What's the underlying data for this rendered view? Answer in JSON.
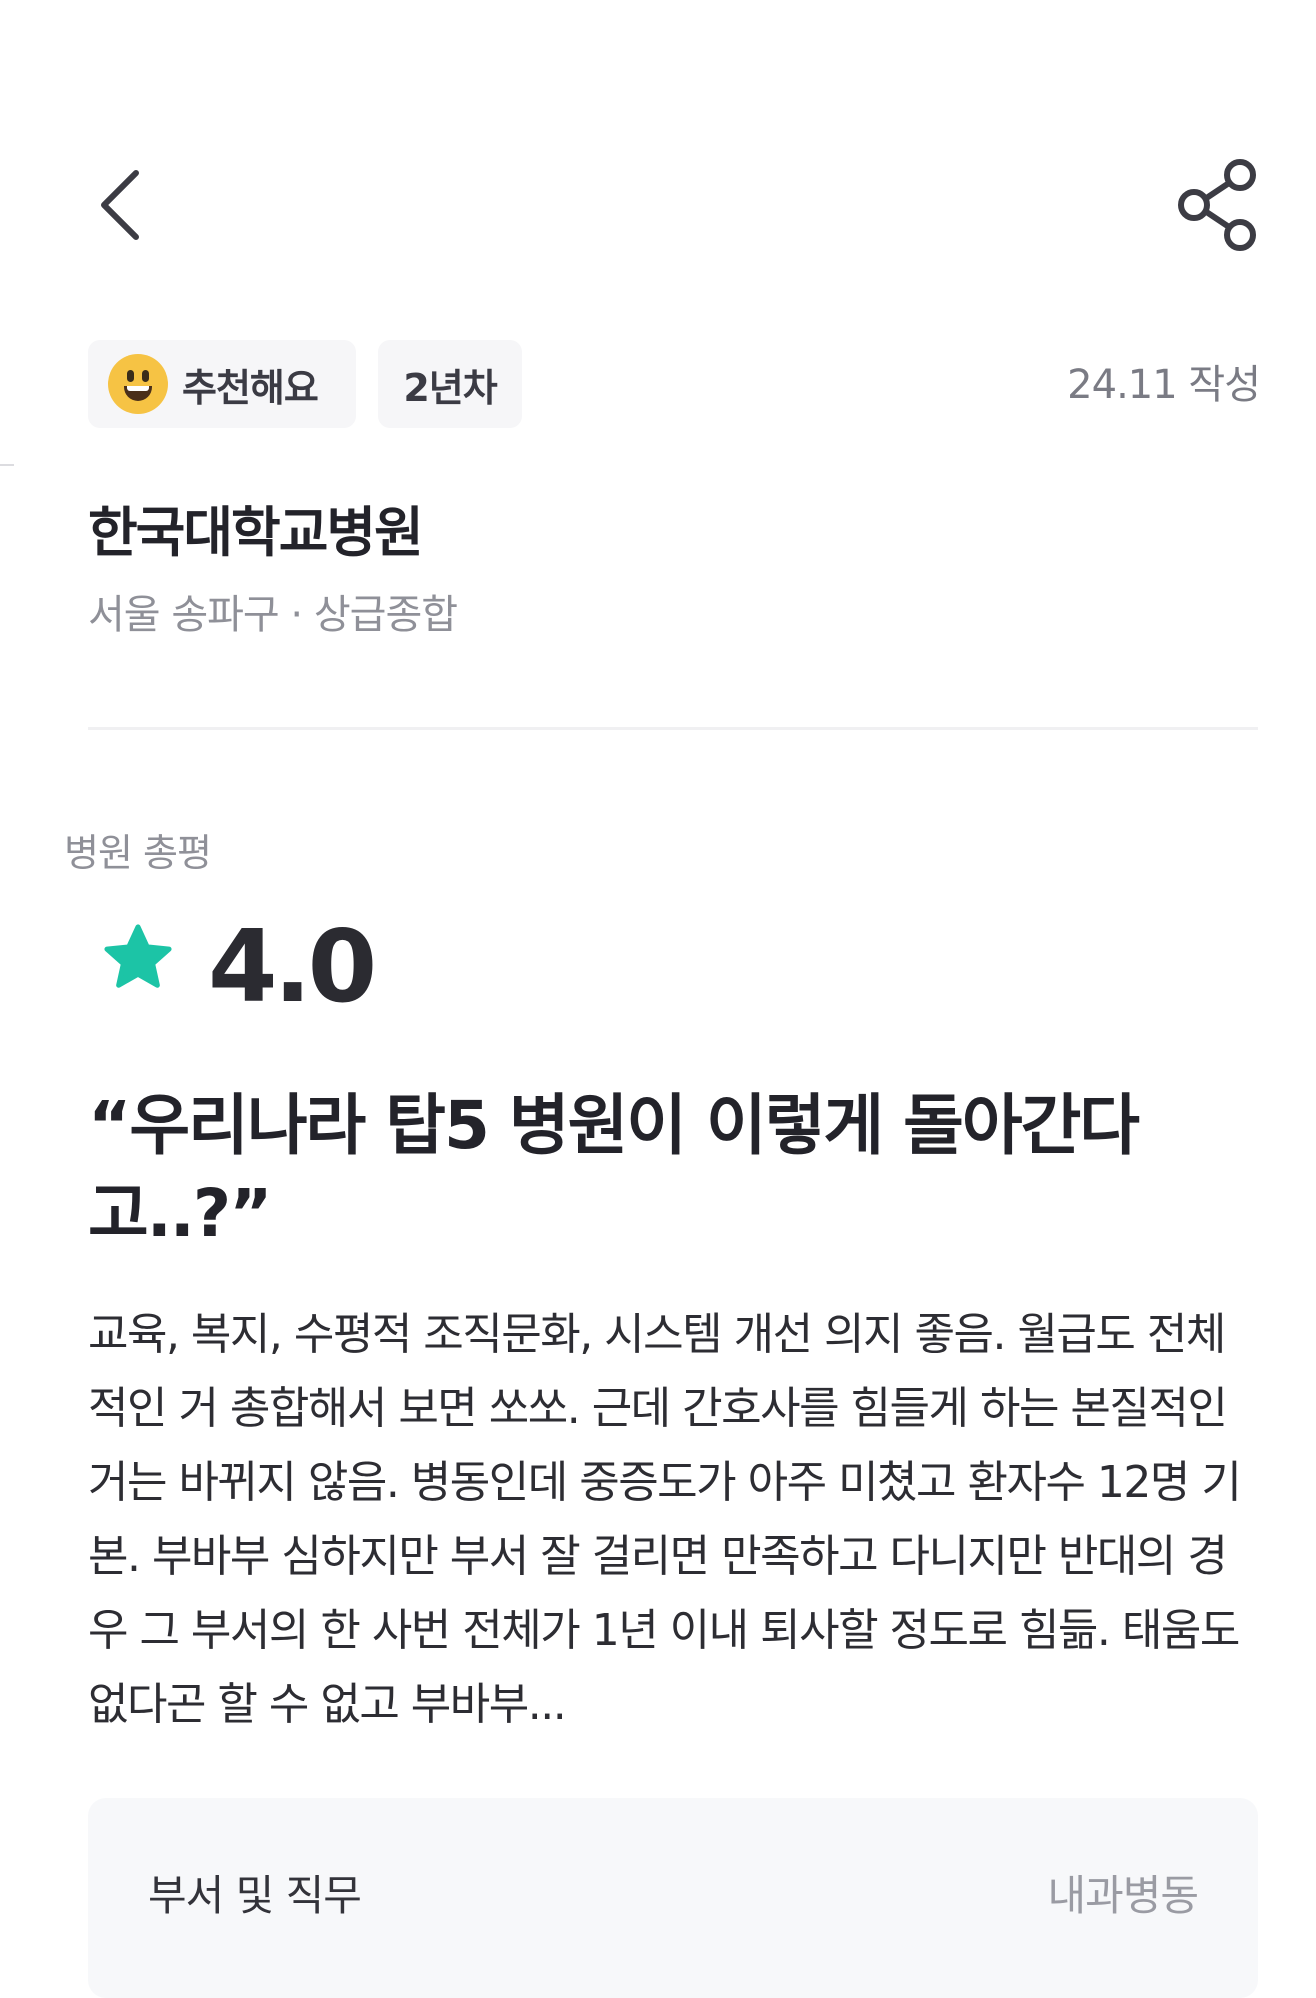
{
  "header": {
    "back_icon": "chevron-left-icon",
    "share_icon": "share-icon"
  },
  "review": {
    "recommend_label": "추천해요",
    "recommend_emoji": "grinning-face-icon",
    "years_label": "2년차",
    "written_date": "24.11 작성"
  },
  "hospital": {
    "name": "한국대학교병원",
    "meta": "서울 송파구 · 상급종합"
  },
  "overall": {
    "section_label": "병원 총평",
    "rating": "4.0",
    "star_color": "#1cc4a6",
    "headline": "“우리나라 탑5 병원이 이렇게 돌아간다고..?”",
    "body": "교육, 복지, 수평적 조직문화, 시스템 개선 의지 좋음. 월급도 전체적인 거 총합해서 보면 쏘쏘. 근데 간호사를 힘들게 하는 본질적인 거는 바뀌지 않음. 병동인데 중증도가 아주 미쳤고 환자수 12명 기본. 부바부 심하지만 부서 잘 걸리면 만족하고 다니지만 반대의 경우 그 부서의 한 사번 전체가 1년 이내 퇴사할 정도로 힘듦. 태움도 없다곤 할 수 없고 부바부..."
  },
  "details": {
    "department_label": "부서 및 직무",
    "department_value": "내과병동"
  }
}
